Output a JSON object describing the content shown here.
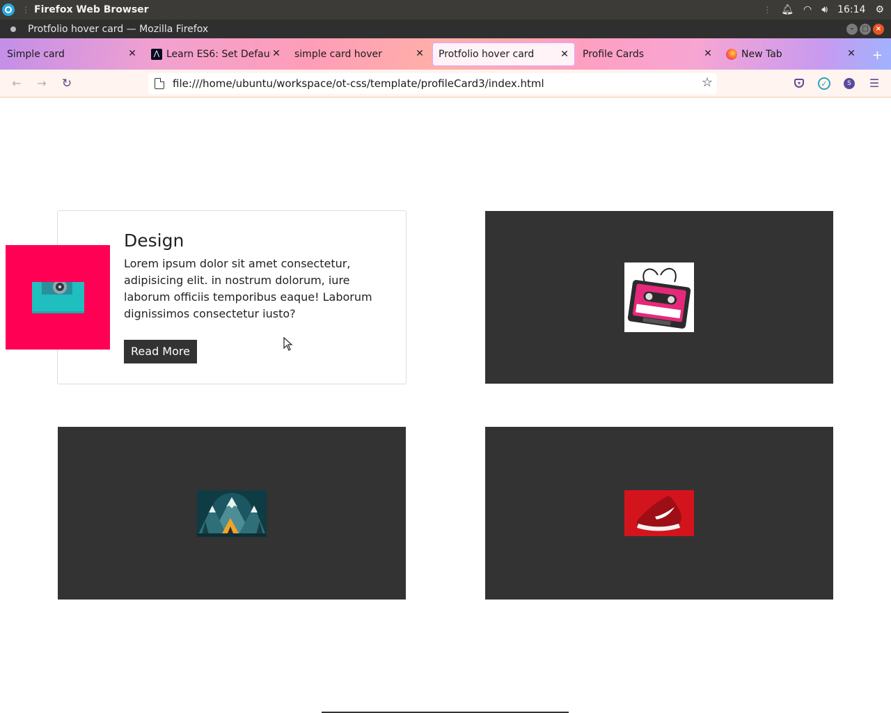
{
  "os": {
    "app_name": "Firefox Web Browser",
    "time": "16:14"
  },
  "window": {
    "title": "Protfolio hover card — Mozilla Firefox"
  },
  "tabs": [
    {
      "label": "Simple card",
      "active": false
    },
    {
      "label": "Learn ES6: Set Default",
      "active": false
    },
    {
      "label": "simple card hover",
      "active": false
    },
    {
      "label": "Protfolio hover card",
      "active": true
    },
    {
      "label": "Profile Cards",
      "active": false
    },
    {
      "label": "New Tab",
      "active": false
    }
  ],
  "navbar": {
    "url": "file:///home/ubuntu/workspace/ot-css/template/profileCard3/index.html",
    "account_initial": "S"
  },
  "cards": [
    {
      "title": "Design",
      "text": "Lorem ipsum dolor sit amet consectetur, adipisicing elit. in nostrum dolorum, iure laborum officiis temporibus eaque! Laborum dignissimos consectetur iusto?",
      "button": "Read More",
      "image": "turntable-image"
    },
    {
      "image": "cassette-tape-image"
    },
    {
      "image": "mountain-tent-image"
    },
    {
      "image": "red-sneaker-image"
    }
  ],
  "colors": {
    "card_dark": "#333333",
    "accent_pink": "#ff0055",
    "firefox_accent": "#5b4a9c"
  }
}
